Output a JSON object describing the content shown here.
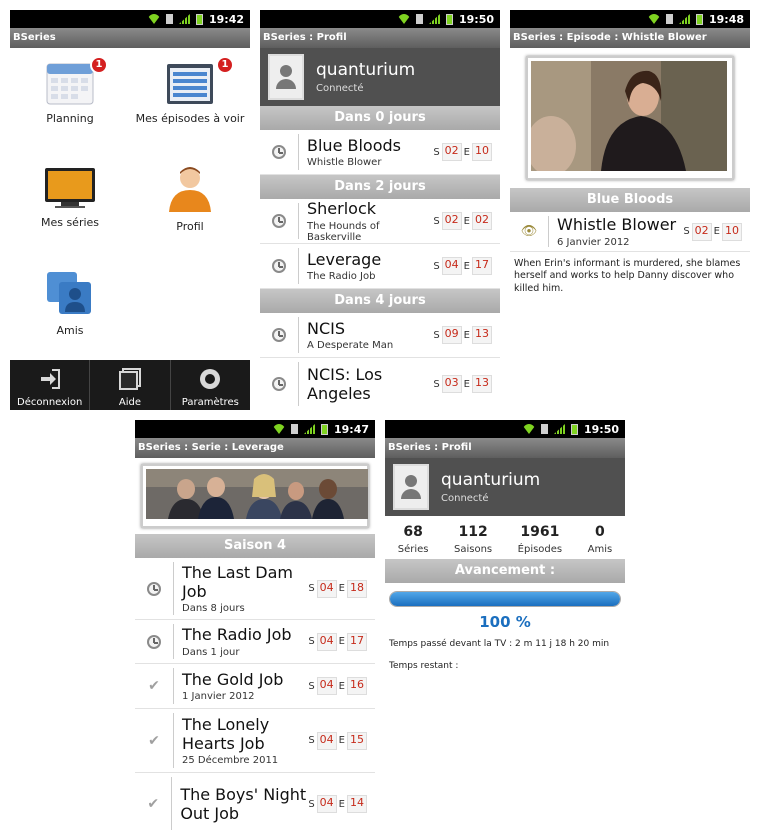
{
  "statusbar": {
    "screen1_time": "19:42",
    "screen2_time": "19:50",
    "screen3_time": "19:48",
    "screen4_time": "19:47",
    "screen5_time": "19:50"
  },
  "home": {
    "title": "BSeries",
    "items": [
      {
        "label": "Planning",
        "icon": "calendar-icon",
        "badge": "1"
      },
      {
        "label": "Mes épisodes à voir",
        "icon": "episodes-list-icon",
        "badge": "1"
      },
      {
        "label": "Mes séries",
        "icon": "tv-icon",
        "badge": ""
      },
      {
        "label": "Profil",
        "icon": "user-icon",
        "badge": ""
      },
      {
        "label": "Amis",
        "icon": "friends-icon",
        "badge": ""
      }
    ],
    "bottom": [
      {
        "label": "Déconnexion",
        "icon": "logout-icon"
      },
      {
        "label": "Aide",
        "icon": "help-icon"
      },
      {
        "label": "Paramètres",
        "icon": "settings-icon"
      }
    ]
  },
  "profile_list": {
    "title": "BSeries : Profil",
    "user": "quanturium",
    "status": "Connecté",
    "sections": [
      {
        "header": "Dans 0 jours",
        "rows": [
          {
            "title": "Blue Bloods",
            "sub": "Whistle Blower",
            "s": "02",
            "e": "10"
          }
        ]
      },
      {
        "header": "Dans 2 jours",
        "rows": [
          {
            "title": "Sherlock",
            "sub": "The Hounds of Baskerville",
            "s": "02",
            "e": "02"
          },
          {
            "title": "Leverage",
            "sub": "The Radio Job",
            "s": "04",
            "e": "17"
          }
        ]
      },
      {
        "header": "Dans 4 jours",
        "rows": [
          {
            "title": "NCIS",
            "sub": "A Desperate Man",
            "s": "09",
            "e": "13"
          },
          {
            "title": "NCIS: Los Angeles",
            "sub": "",
            "s": "03",
            "e": "13"
          }
        ]
      }
    ]
  },
  "episode": {
    "title": "BSeries : Episode : Whistle Blower",
    "show": "Blue Bloods",
    "ep_title": "Whistle Blower",
    "date": "6 Janvier 2012",
    "s": "02",
    "e": "10",
    "description": "When Erin's informant is murdered, she blames herself and works to help Danny discover who killed him."
  },
  "serie": {
    "title": "BSeries : Serie : Leverage",
    "season": "Saison 4",
    "rows": [
      {
        "title": "The Last Dam Job",
        "sub": "Dans 8 jours",
        "s": "04",
        "e": "18",
        "state": "clock"
      },
      {
        "title": "The Radio Job",
        "sub": "Dans 1 jour",
        "s": "04",
        "e": "17",
        "state": "clock"
      },
      {
        "title": "The Gold Job",
        "sub": "1 Janvier 2012",
        "s": "04",
        "e": "16",
        "state": "check"
      },
      {
        "title": "The Lonely Hearts Job",
        "sub": "25 Décembre 2011",
        "s": "04",
        "e": "15",
        "state": "check"
      },
      {
        "title": "The Boys' Night Out Job",
        "sub": "",
        "s": "04",
        "e": "14",
        "state": "check"
      }
    ]
  },
  "profile_stats": {
    "title": "BSeries : Profil",
    "user": "quanturium",
    "status": "Connecté",
    "stats": [
      {
        "value": "68",
        "label": "Séries"
      },
      {
        "value": "112",
        "label": "Saisons"
      },
      {
        "value": "1961",
        "label": "Épisodes"
      },
      {
        "value": "0",
        "label": "Amis"
      }
    ],
    "progress_header": "Avancement :",
    "progress_value": 1.0,
    "progress_text": "100 %",
    "tv_time": "Temps passé devant la TV : 2 m 11 j 18 h 20 min",
    "remaining": "Temps restant :"
  },
  "labels": {
    "s": "S",
    "e": "E"
  }
}
